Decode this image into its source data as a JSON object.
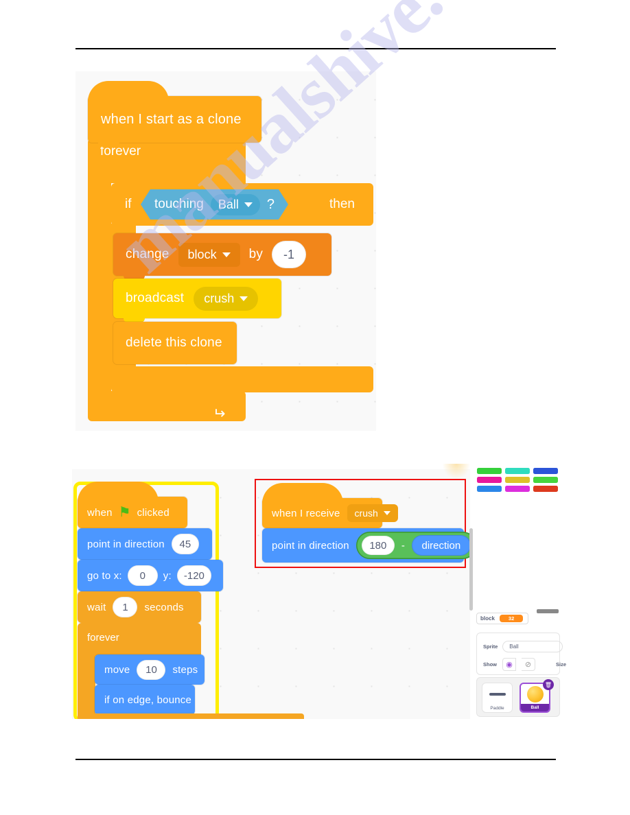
{
  "document": {
    "watermark": "manualshive.com",
    "header_rule": true,
    "footer_rule": true
  },
  "figure1": {
    "name": "clone-collision-script",
    "blocks": [
      {
        "id": "hat",
        "type": "event-hat",
        "label": "when I start as a clone"
      },
      {
        "id": "forever",
        "type": "control-c",
        "label": "forever"
      },
      {
        "id": "if",
        "type": "control-c",
        "label_if": "if",
        "label_then": "then"
      },
      {
        "id": "touching",
        "type": "sensing-boolean",
        "label": "touching",
        "dropdown": "Ball",
        "suffix": "?"
      },
      {
        "id": "change",
        "type": "variable",
        "label": "change",
        "dropdown": "block",
        "by_label": "by",
        "value": "-1"
      },
      {
        "id": "broadcast",
        "type": "event",
        "label": "broadcast",
        "dropdown": "crush"
      },
      {
        "id": "delete",
        "type": "control",
        "label": "delete this clone"
      }
    ]
  },
  "figure2": {
    "name": "ball-scripts",
    "left_script": {
      "highlighted": true,
      "blocks": [
        {
          "id": "whenflag",
          "label_before": "when",
          "icon": "green-flag-icon",
          "label_after": "clicked"
        },
        {
          "id": "point45",
          "label": "point in direction",
          "value": "45"
        },
        {
          "id": "goto",
          "label_x": "go to x:",
          "value_x": "0",
          "label_y": "y:",
          "value_y": "-120"
        },
        {
          "id": "wait",
          "label": "wait",
          "value": "1",
          "suffix": "seconds"
        },
        {
          "id": "forever",
          "label": "forever"
        },
        {
          "id": "move",
          "label": "move",
          "value": "10",
          "suffix": "steps"
        },
        {
          "id": "bounce",
          "label": "if on edge, bounce"
        }
      ]
    },
    "right_script": {
      "outlined": true,
      "outline_color": "#ee1111",
      "blocks": [
        {
          "id": "whenreceive",
          "label": "when I receive",
          "dropdown": "crush"
        },
        {
          "id": "pointdir",
          "label": "point in direction",
          "value": "180",
          "operator": "-",
          "reporter": "direction"
        }
      ]
    },
    "stage_panel": {
      "swatches": [
        "#35d03a",
        "#2fdcbe",
        "#2b54d8",
        "#e8189b",
        "#ddc22a",
        "#46d43d",
        "#2b86e8",
        "#dd2edd",
        "#dd3a1e"
      ],
      "variable_monitor": {
        "name": "block",
        "value": "32"
      },
      "sprite_fields": {
        "sprite_label": "Sprite",
        "sprite_name": "Ball",
        "show_label": "Show",
        "show_on_icon": "eye-visible-icon",
        "show_off_icon": "eye-hidden-icon",
        "size_label": "Size"
      },
      "sprites": [
        {
          "name": "Paddle",
          "selected": false,
          "glyph": "paddle-icon"
        },
        {
          "name": "Ball",
          "selected": true,
          "glyph": "ball-icon",
          "delete_icon": "trash-icon"
        }
      ]
    }
  },
  "colors": {
    "event": "#ffab19",
    "control": "#ffab19",
    "motion": "#4c97ff",
    "sensing": "#5cb1d6",
    "variable": "#f2861a",
    "message": "#ffd500",
    "operator": "#59c059",
    "highlight_glow": "#ffee00",
    "selection_outline": "#ee1111"
  }
}
